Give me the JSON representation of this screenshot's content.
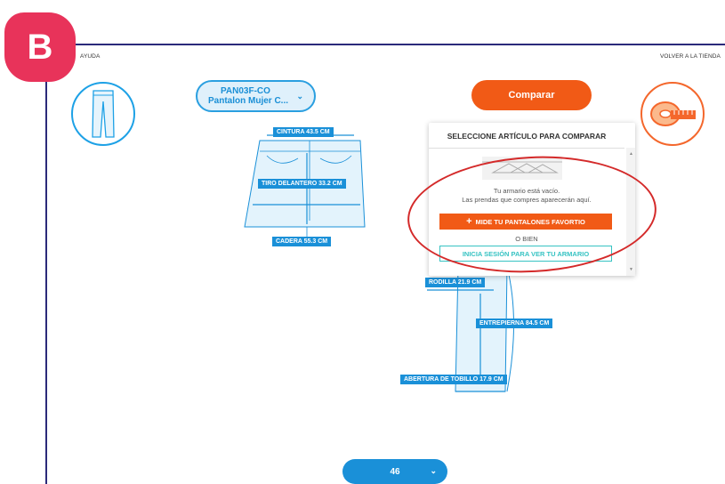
{
  "annotation": {
    "badge": "B"
  },
  "nav": {
    "help": "AYUDA",
    "back_to_store": "VOLVER A LA TIENDA"
  },
  "product": {
    "code": "PAN03F-CO",
    "name": "Pantalon Mujer C..."
  },
  "compare": {
    "label": "Comparar"
  },
  "measurements": {
    "waist": "CINTURA 43.5 CM",
    "front_rise": "TIRO DELANTERO 33.2 CM",
    "hip": "CADERA 55.3 CM",
    "knee": "RODILLA 21.9 CM",
    "inseam": "ENTREPIERNA 84.5 CM",
    "ankle_opening": "ABERTURA DE TOBILLO 17.9 CM"
  },
  "compare_panel": {
    "title": "SELECCIONE ARTÍCULO PARA COMPARAR",
    "empty_line1": "Tu armario está vacío.",
    "empty_line2": "Las prendas que compres aparecerán aquí.",
    "measure_button": "MIDE TU PANTALONES FAVORTIO",
    "or": "O BIEN",
    "login_button": "INICIA SESIÓN PARA VER TU ARMARIO"
  },
  "size_selector": {
    "value": "46"
  },
  "colors": {
    "blue": "#1a90d8",
    "orange": "#f15a16",
    "red_annotation": "#d42a2a",
    "badge": "#e8335a",
    "frame": "#2b2a7a"
  },
  "icons": {
    "pants": "pants-icon",
    "tape": "measuring-tape-icon",
    "hanger": "hangers-icon"
  }
}
